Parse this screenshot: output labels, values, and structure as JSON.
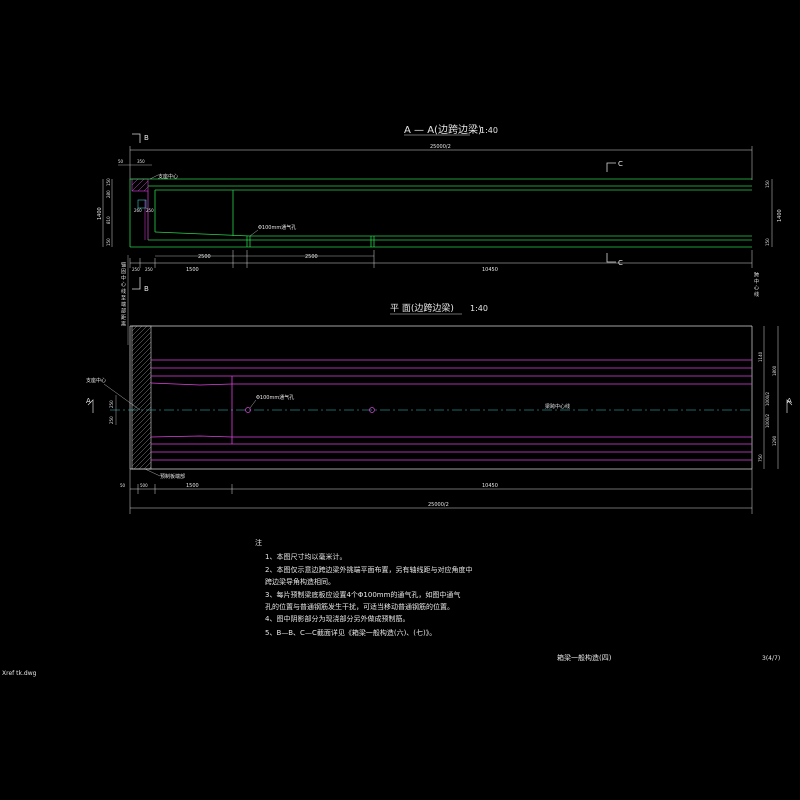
{
  "section_title": {
    "label": "A — A(边跨边梁)",
    "scale": "1:40"
  },
  "plan_title": {
    "label": "平 面(边跨边梁)",
    "scale": "1:40"
  },
  "cut_labels": {
    "b_top": "B",
    "b_bottom": "B",
    "c_top": "C",
    "c_bottom": "C",
    "a_left": "A",
    "a_right": "A"
  },
  "section_dims": {
    "overall": "25000/2",
    "top_left_a": "50",
    "top_left_b": "350",
    "left_height": "1400",
    "left_sub": [
      "150",
      "280",
      "810",
      "150"
    ],
    "inner_sub": [
      "260",
      "250"
    ],
    "right_height": "1400",
    "right_sub": [
      "150",
      "150"
    ],
    "bottom": [
      "250",
      "250",
      "1500",
      "2500",
      "2500",
      "10450"
    ]
  },
  "section_labels": {
    "vent": "Φ100mm通气孔",
    "support": "支座中心"
  },
  "left_vertical_text": "锚 固 中 心 线 至 端 部 距 离",
  "right_vertical_text": "跨 中 心 线",
  "plan_dims": {
    "right": [
      "1140",
      "1800",
      "1000/2",
      "1000/2",
      "1290",
      "750"
    ],
    "left": [
      "250",
      "250"
    ],
    "bottom_row": [
      "50",
      "500",
      "1500",
      "10450"
    ],
    "overall": "25000/2"
  },
  "plan_labels": {
    "support_center": "支座中心",
    "vent": "Φ100mm通气孔",
    "centerline": "梁跨中心线",
    "end_plate": "预制板端部"
  },
  "notes": {
    "heading": "注",
    "items": [
      "1、本图尺寸均以毫米计。",
      "2、本图仅示意边跨边梁外挑端平面布置，另有轴线距与对应角度中",
      "   跨边梁导角构造相同。",
      "3、每片预制梁底板应设置4个Φ100mm的通气孔，如图中通气",
      "   孔的位置与普通钢筋发生干扰，可适当移动普通钢筋的位置。",
      "4、图中阴影部分为现浇部分另外做成预制筋。",
      "5、B—B、C—C截面详见《箱梁一般构造(六)、(七)》。"
    ]
  },
  "title_block": {
    "drawing_name": "箱梁一般构造(四)",
    "sheet": "3(4/7)"
  },
  "filename": "Xref tk.dwg",
  "colors": {
    "green": "#28d24a",
    "magenta": "#e040e0",
    "white": "#d8d8d8",
    "cyan": "#38c8c8",
    "bg": "#000000"
  }
}
